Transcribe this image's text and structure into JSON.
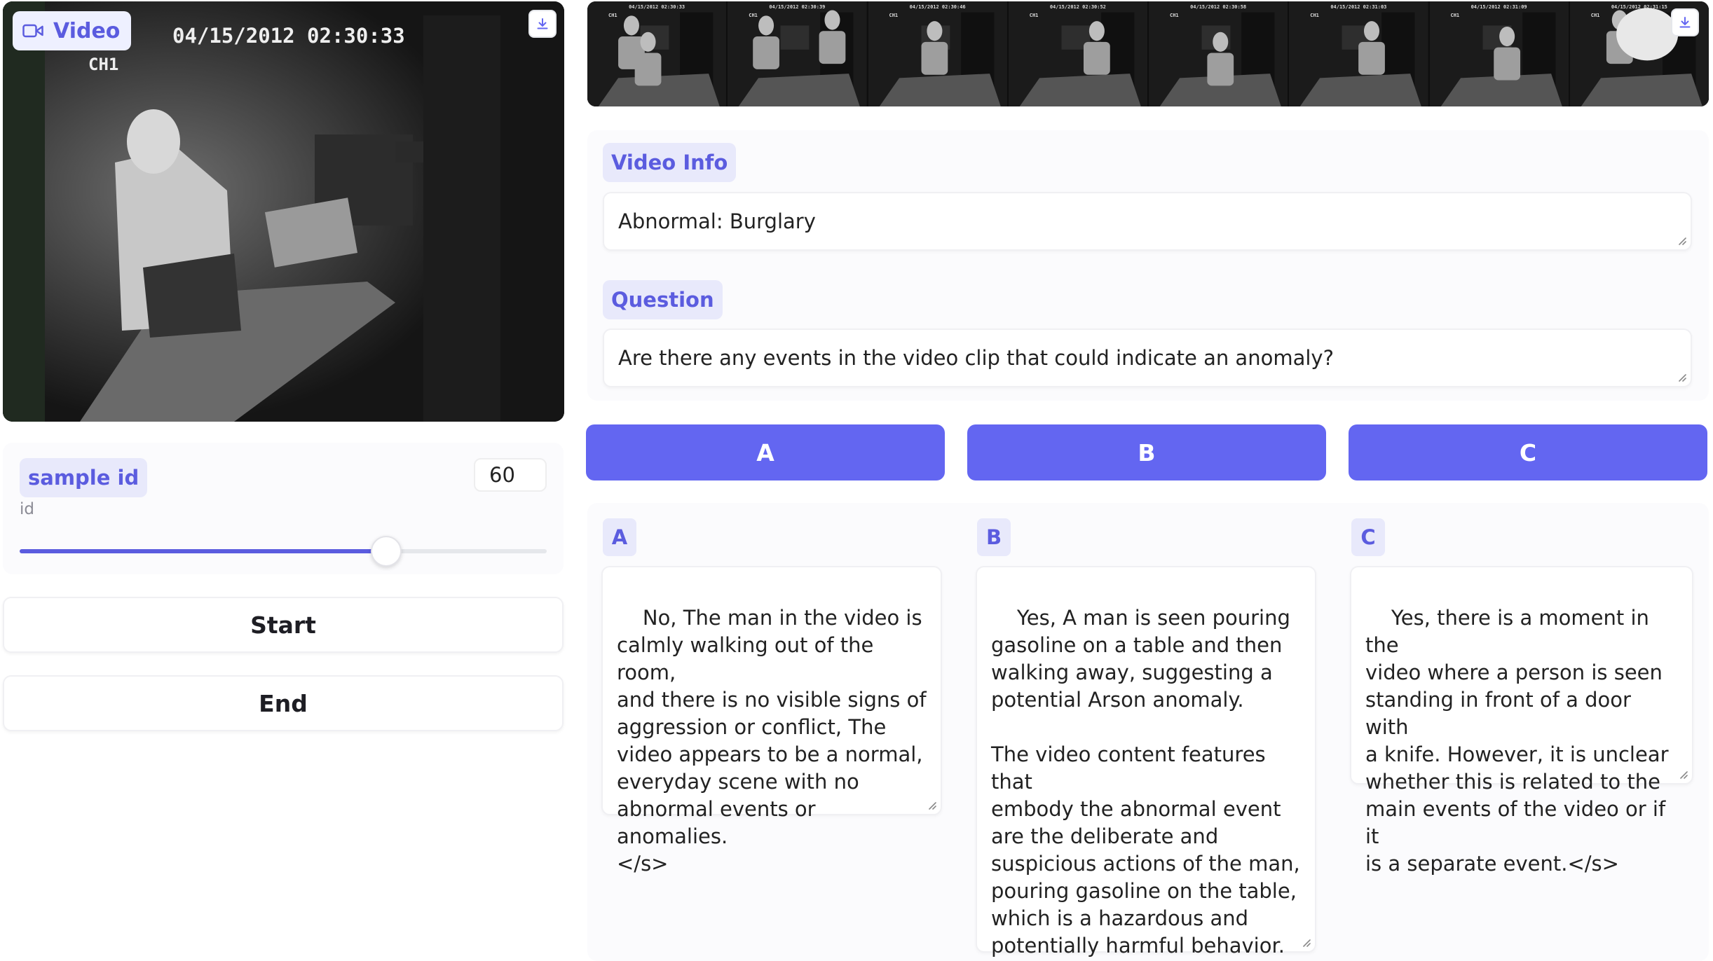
{
  "video": {
    "label": "Video",
    "timestamp": "04/15/2012 02:30:33",
    "channel": "CH1"
  },
  "thumbnails": [
    {
      "time": "04/15/2012 02:30:33",
      "channel": "CH1"
    },
    {
      "time": "04/15/2012 02:30:39",
      "channel": "CH1"
    },
    {
      "time": "04/15/2012 02:30:46",
      "channel": "CH1"
    },
    {
      "time": "04/15/2012 02:30:52",
      "channel": "CH1"
    },
    {
      "time": "04/15/2012 02:30:58",
      "channel": "CH1"
    },
    {
      "time": "04/15/2012 02:31:03",
      "channel": "CH1"
    },
    {
      "time": "04/15/2012 02:31:09",
      "channel": "CH1"
    },
    {
      "time": "04/15/2012 02:31:15",
      "channel": "CH1"
    }
  ],
  "sample": {
    "label": "sample id",
    "value": "60",
    "sub_label": "id",
    "slider_fraction": 0.695
  },
  "controls": {
    "start_label": "Start",
    "end_label": "End"
  },
  "video_info": {
    "label": "Video Info",
    "value": "Abnormal: Burglary"
  },
  "question": {
    "label": "Question",
    "value": "Are there any events in the video clip that could indicate an anomaly?"
  },
  "choices": {
    "a_label": "A",
    "b_label": "B",
    "c_label": "C"
  },
  "answers": {
    "a": {
      "label": "A",
      "text": "No, The man in the video is\ncalmly walking out of the room,\nand there is no visible signs of\naggression or conflict, The\nvideo appears to be a normal,\neveryday scene with no\nabnormal events or anomalies.\n</s>"
    },
    "b": {
      "label": "B",
      "text": "Yes, A man is seen pouring\ngasoline on a table and then\nwalking away, suggesting a\npotential Arson anomaly.\n\nThe video content features that\nembody the abnormal event\nare the deliberate and\nsuspicious actions of the man,\npouring gasoline on the table,\nwhich is a hazardous and\npotentially harmful behavior.\n</s>"
    },
    "c": {
      "label": "C",
      "text": "Yes, there is a moment in the\nvideo where a person is seen\nstanding in front of a door with\na knife. However, it is unclear\nwhether this is related to the\nmain events of the video or if it\nis a separate event.</s>"
    }
  },
  "colors": {
    "accent": "#6366f1",
    "badge_bg": "#e8e9fb",
    "badge_text": "#5b5cdf"
  },
  "icons": {
    "video_label": "video-camera-icon",
    "download": "download-icon"
  }
}
